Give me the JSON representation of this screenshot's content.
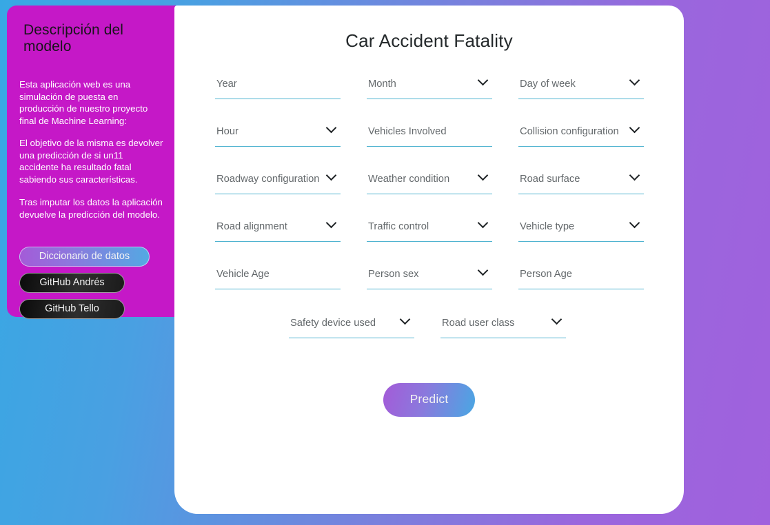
{
  "theme": {
    "background_left": "#37a8e4",
    "background_right": "#a061dd",
    "sidebar_bg": "#c518c7",
    "card_bg": "#ffffff",
    "field_underline": "#4fb3d0",
    "accent_gradient_from": "#a45bd8",
    "accent_gradient_to": "#49a7e3"
  },
  "sidebar": {
    "title": "Descripción del modelo",
    "paragraphs": [
      "Esta aplicación web es una simulación de puesta en producción de nuestro proyecto final de Machine Learning:",
      "El objetivo de la misma es devolver una predicción de si un11 accidente ha resultado fatal sabiendo sus características.",
      "Tras imputar los datos la aplicación devuelve la predicción del modelo."
    ],
    "buttons": [
      {
        "label": "Diccionario de datos"
      },
      {
        "label": "GitHub Andrés"
      },
      {
        "label": "GitHub Tello"
      }
    ]
  },
  "main": {
    "title": "Car Accident Fatality",
    "predict_label": "Predict",
    "rows": [
      [
        {
          "label": "Year",
          "type": "text"
        },
        {
          "label": "Month",
          "type": "select"
        },
        {
          "label": "Day of week",
          "type": "select"
        }
      ],
      [
        {
          "label": "Hour",
          "type": "select"
        },
        {
          "label": "Vehicles Involved",
          "type": "text"
        },
        {
          "label": "Collision configuration",
          "type": "select"
        }
      ],
      [
        {
          "label": "Roadway configuration",
          "type": "select"
        },
        {
          "label": "Weather condition",
          "type": "select"
        },
        {
          "label": "Road surface",
          "type": "select"
        }
      ],
      [
        {
          "label": "Road alignment",
          "type": "select"
        },
        {
          "label": "Traffic control",
          "type": "select"
        },
        {
          "label": "Vehicle type",
          "type": "select"
        }
      ],
      [
        {
          "label": "Vehicle Age",
          "type": "text"
        },
        {
          "label": "Person sex",
          "type": "select"
        },
        {
          "label": "Person Age",
          "type": "text"
        }
      ]
    ],
    "last_row": [
      {
        "label": "Safety device used",
        "type": "select"
      },
      {
        "label": "Road user class",
        "type": "select"
      }
    ]
  }
}
